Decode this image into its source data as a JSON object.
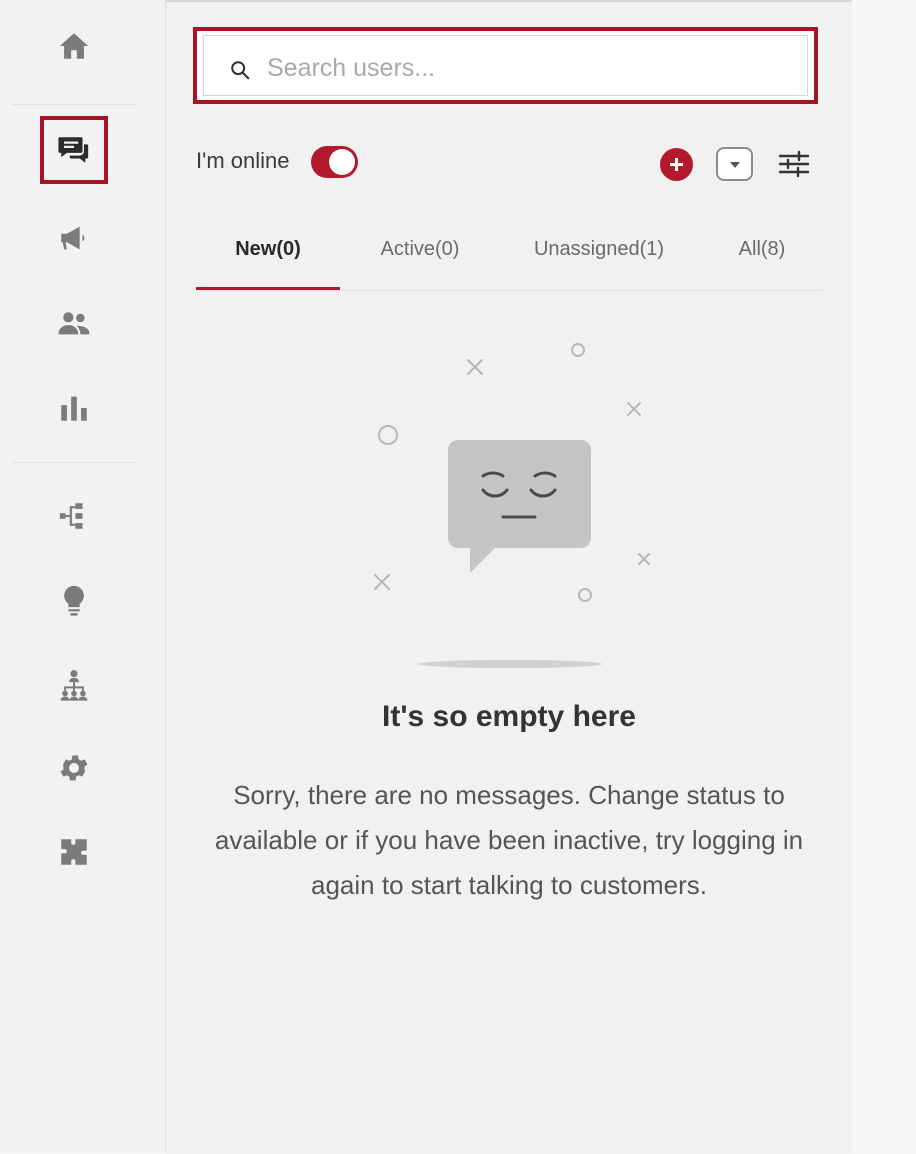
{
  "sidebar": {
    "items": [
      {
        "name": "home-icon",
        "active": false
      },
      {
        "name": "chat-icon",
        "active": true
      },
      {
        "name": "megaphone-icon",
        "active": false
      },
      {
        "name": "users-icon",
        "active": false
      },
      {
        "name": "bar-chart-icon",
        "active": false
      },
      {
        "name": "flow-icon",
        "active": false
      },
      {
        "name": "lightbulb-icon",
        "active": false
      },
      {
        "name": "org-chart-icon",
        "active": false
      },
      {
        "name": "gear-icon",
        "active": false
      },
      {
        "name": "puzzle-icon",
        "active": false
      }
    ]
  },
  "search": {
    "placeholder": "Search users..."
  },
  "status": {
    "label": "I'm online",
    "online": true
  },
  "toolbar": {
    "add_icon": "plus-icon",
    "dropdown_icon": "chevron-down-icon",
    "filter_icon": "sliders-icon"
  },
  "tabs": [
    {
      "label": "New(0)",
      "active": true
    },
    {
      "label": "Active(0)",
      "active": false
    },
    {
      "label": "Unassigned(1)",
      "active": false
    },
    {
      "label": "All(8)",
      "active": false
    }
  ],
  "empty_state": {
    "title": "It's so empty here",
    "description": "Sorry, there are no messages. Change status to available or if you have been inactive, try logging in again to start talking to customers."
  },
  "colors": {
    "accent": "#b3192d",
    "highlight_border": "#a41426",
    "icon_gray": "#7b7b7b"
  }
}
